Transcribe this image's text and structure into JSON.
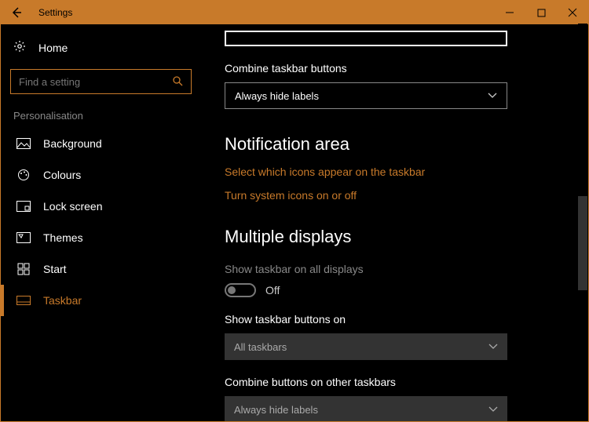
{
  "window": {
    "title": "Settings"
  },
  "sidebar": {
    "home": "Home",
    "search_placeholder": "Find a setting",
    "section": "Personalisation",
    "items": [
      {
        "label": "Background"
      },
      {
        "label": "Colours"
      },
      {
        "label": "Lock screen"
      },
      {
        "label": "Themes"
      },
      {
        "label": "Start"
      },
      {
        "label": "Taskbar"
      }
    ]
  },
  "content": {
    "combine_label": "Combine taskbar buttons",
    "combine_value": "Always hide labels",
    "notification_heading": "Notification area",
    "link_icons": "Select which icons appear on the taskbar",
    "link_system": "Turn system icons on or off",
    "multiple_heading": "Multiple displays",
    "show_all_label": "Show taskbar on all displays",
    "toggle_state": "Off",
    "show_buttons_label": "Show taskbar buttons on",
    "show_buttons_value": "All taskbars",
    "combine_other_label": "Combine buttons on other taskbars",
    "combine_other_value": "Always hide labels"
  }
}
